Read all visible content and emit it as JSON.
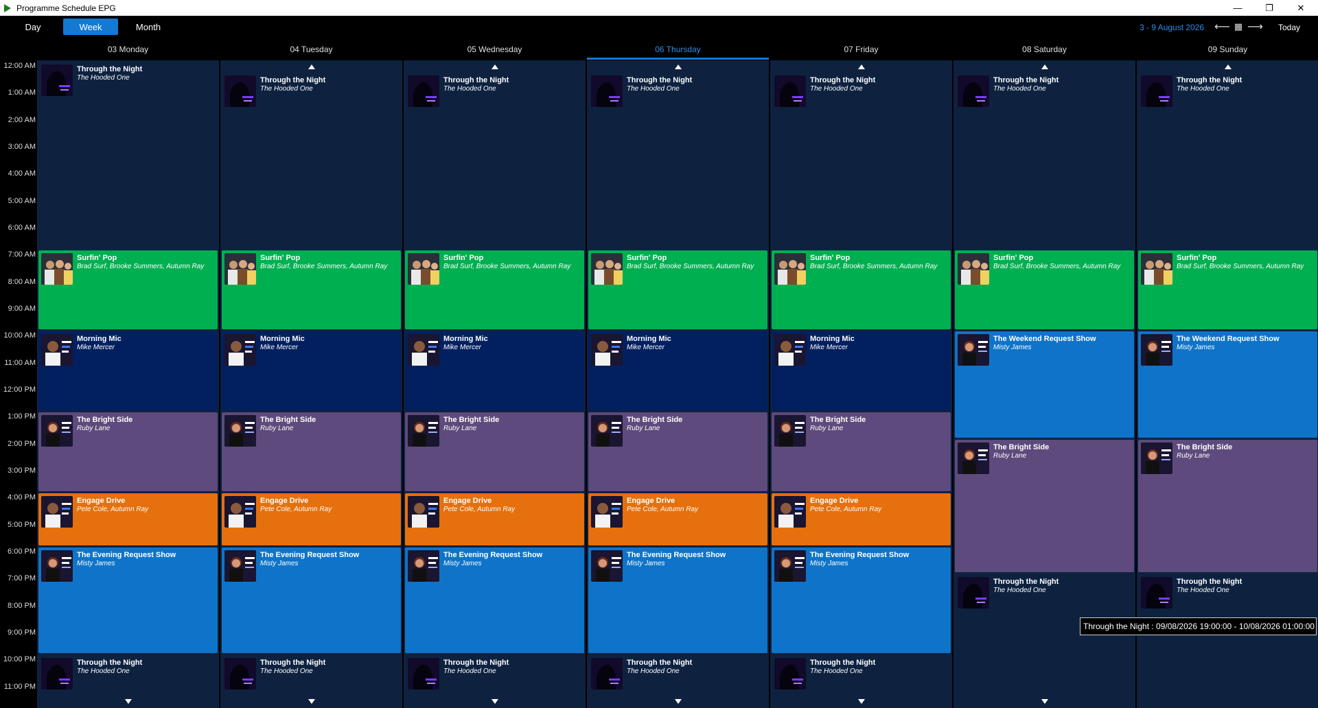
{
  "window": {
    "title": "Programme Schedule EPG",
    "controls": {
      "minimize": "—",
      "maximize": "❐",
      "close": "✕"
    }
  },
  "toolbar": {
    "views": [
      {
        "label": "Day",
        "active": false
      },
      {
        "label": "Week",
        "active": true
      },
      {
        "label": "Month",
        "active": false
      }
    ],
    "range": "3  - 9 August 2026",
    "prev": "⟵",
    "calendar": "▦",
    "next": "⟶",
    "today": "Today"
  },
  "days": [
    {
      "label": "03 Monday",
      "today": false
    },
    {
      "label": "04 Tuesday",
      "today": false
    },
    {
      "label": "05 Wednesday",
      "today": false
    },
    {
      "label": "06 Thursday",
      "today": true
    },
    {
      "label": "07 Friday",
      "today": false
    },
    {
      "label": "08 Saturday",
      "today": false
    },
    {
      "label": "09 Sunday",
      "today": false
    }
  ],
  "times": [
    "12:00 AM",
    "1:00 AM",
    "2:00 AM",
    "3:00 AM",
    "4:00 AM",
    "5:00 AM",
    "6:00 AM",
    "7:00 AM",
    "8:00 AM",
    "9:00 AM",
    "10:00 AM",
    "11:00 AM",
    "12:00 PM",
    "1:00 PM",
    "2:00 PM",
    "3:00 PM",
    "4:00 PM",
    "5:00 PM",
    "6:00 PM",
    "7:00 PM",
    "8:00 PM",
    "9:00 PM",
    "10:00 PM",
    "11:00 PM"
  ],
  "shows": {
    "night": {
      "title": "Through the Night",
      "host": "The Hooded One",
      "color": "#0e2240",
      "thumb": "night"
    },
    "surfin": {
      "title": "Surfin' Pop",
      "host": "Brad Surf, Brooke Summers, Autumn Ray",
      "color": "#00b050",
      "thumb": "group"
    },
    "morning": {
      "title": "Morning Mic",
      "host": "Mike Mercer",
      "color": "#02205f",
      "thumb": "man"
    },
    "weekend": {
      "title": "The Weekend Request Show",
      "host": "Misty James",
      "color": "#0f74c9",
      "thumb": "woman"
    },
    "bright": {
      "title": "The Bright Side",
      "host": "Ruby Lane",
      "color": "#5e4a7c",
      "thumb": "woman"
    },
    "engage": {
      "title": "Engage Drive",
      "host": "Pete Cole, Autumn Ray",
      "color": "#e6700d",
      "thumb": "man"
    },
    "evening": {
      "title": "The Evening Request Show",
      "host": "Misty James",
      "color": "#0f74c9",
      "thumb": "woman"
    }
  },
  "schedule": [
    [
      {
        "show": "night",
        "start": 0,
        "end": 7,
        "prev": false
      },
      {
        "show": "surfin",
        "start": 7,
        "end": 10
      },
      {
        "show": "morning",
        "start": 10,
        "end": 13
      },
      {
        "show": "bright",
        "start": 13,
        "end": 16
      },
      {
        "show": "engage",
        "start": 16,
        "end": 18
      },
      {
        "show": "evening",
        "start": 18,
        "end": 22
      },
      {
        "show": "night",
        "start": 22,
        "end": 24,
        "next": true
      }
    ],
    [
      {
        "show": "night",
        "start": 0,
        "end": 7,
        "prev": true
      },
      {
        "show": "surfin",
        "start": 7,
        "end": 10
      },
      {
        "show": "morning",
        "start": 10,
        "end": 13
      },
      {
        "show": "bright",
        "start": 13,
        "end": 16
      },
      {
        "show": "engage",
        "start": 16,
        "end": 18
      },
      {
        "show": "evening",
        "start": 18,
        "end": 22
      },
      {
        "show": "night",
        "start": 22,
        "end": 24,
        "next": true
      }
    ],
    [
      {
        "show": "night",
        "start": 0,
        "end": 7,
        "prev": true
      },
      {
        "show": "surfin",
        "start": 7,
        "end": 10
      },
      {
        "show": "morning",
        "start": 10,
        "end": 13
      },
      {
        "show": "bright",
        "start": 13,
        "end": 16
      },
      {
        "show": "engage",
        "start": 16,
        "end": 18
      },
      {
        "show": "evening",
        "start": 18,
        "end": 22
      },
      {
        "show": "night",
        "start": 22,
        "end": 24,
        "next": true
      }
    ],
    [
      {
        "show": "night",
        "start": 0,
        "end": 7,
        "prev": true
      },
      {
        "show": "surfin",
        "start": 7,
        "end": 10
      },
      {
        "show": "morning",
        "start": 10,
        "end": 13
      },
      {
        "show": "bright",
        "start": 13,
        "end": 16
      },
      {
        "show": "engage",
        "start": 16,
        "end": 18
      },
      {
        "show": "evening",
        "start": 18,
        "end": 22
      },
      {
        "show": "night",
        "start": 22,
        "end": 24,
        "next": true
      }
    ],
    [
      {
        "show": "night",
        "start": 0,
        "end": 7,
        "prev": true
      },
      {
        "show": "surfin",
        "start": 7,
        "end": 10
      },
      {
        "show": "morning",
        "start": 10,
        "end": 13
      },
      {
        "show": "bright",
        "start": 13,
        "end": 16
      },
      {
        "show": "engage",
        "start": 16,
        "end": 18
      },
      {
        "show": "evening",
        "start": 18,
        "end": 22
      },
      {
        "show": "night",
        "start": 22,
        "end": 24,
        "next": true
      }
    ],
    [
      {
        "show": "night",
        "start": 0,
        "end": 7,
        "prev": true
      },
      {
        "show": "surfin",
        "start": 7,
        "end": 10
      },
      {
        "show": "weekend",
        "start": 10,
        "end": 14
      },
      {
        "show": "bright",
        "start": 14,
        "end": 19
      },
      {
        "show": "night",
        "start": 19,
        "end": 24,
        "next": true
      }
    ],
    [
      {
        "show": "night",
        "start": 0,
        "end": 7,
        "prev": true
      },
      {
        "show": "surfin",
        "start": 7,
        "end": 10
      },
      {
        "show": "weekend",
        "start": 10,
        "end": 14
      },
      {
        "show": "bright",
        "start": 14,
        "end": 19
      },
      {
        "show": "night",
        "start": 19,
        "end": 24,
        "next": false
      }
    ]
  ],
  "tooltip": "Through the Night : 09/08/2026 19:00:00 - 10/08/2026 01:00:00"
}
